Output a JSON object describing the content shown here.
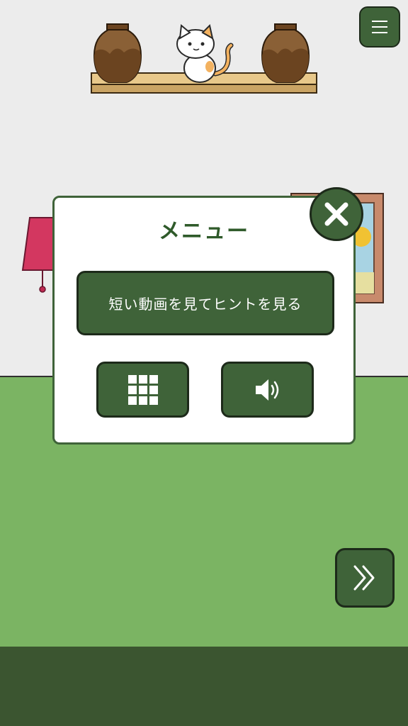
{
  "menu": {
    "title": "メニュー",
    "hint_button_label": "短い動画を見てヒントを見る"
  },
  "icons": {
    "menu": "hamburger-icon",
    "close": "close-icon",
    "grid": "grid-icon",
    "sound": "speaker-icon",
    "next": "double-chevron-right-icon"
  },
  "colors": {
    "button_green": "#3f6339",
    "floor_green": "#7bb463",
    "bottom_bar": "#3b5530",
    "wall": "#ececec",
    "title_green": "#2f5a2a"
  }
}
